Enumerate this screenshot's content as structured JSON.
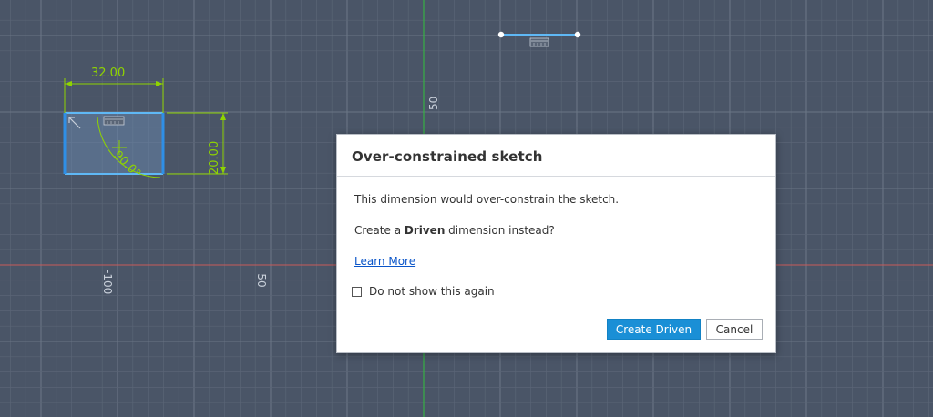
{
  "sketch": {
    "axis_labels": [
      "50",
      "-100",
      "-50"
    ],
    "dimensions": {
      "width": "32.00",
      "height": "20.00",
      "angle": "90.0°"
    },
    "colors": {
      "background": "#4a5567",
      "grid_minor": "#5a6576",
      "grid_major": "#6a7585",
      "y_axis": "#2fbf3a",
      "x_axis": "#c85a5a",
      "dimension": "#8fd400",
      "sketch_line": "#2f8fe6"
    }
  },
  "dialog": {
    "title": "Over-constrained sketch",
    "message": "This dimension would over-constrain the sketch.",
    "question_prefix": "Create a ",
    "question_bold": "Driven",
    "question_suffix": " dimension instead?",
    "learn_more": "Learn More",
    "checkbox_label": "Do not show this again",
    "checkbox_checked": false,
    "primary_button": "Create Driven",
    "cancel_button": "Cancel"
  }
}
